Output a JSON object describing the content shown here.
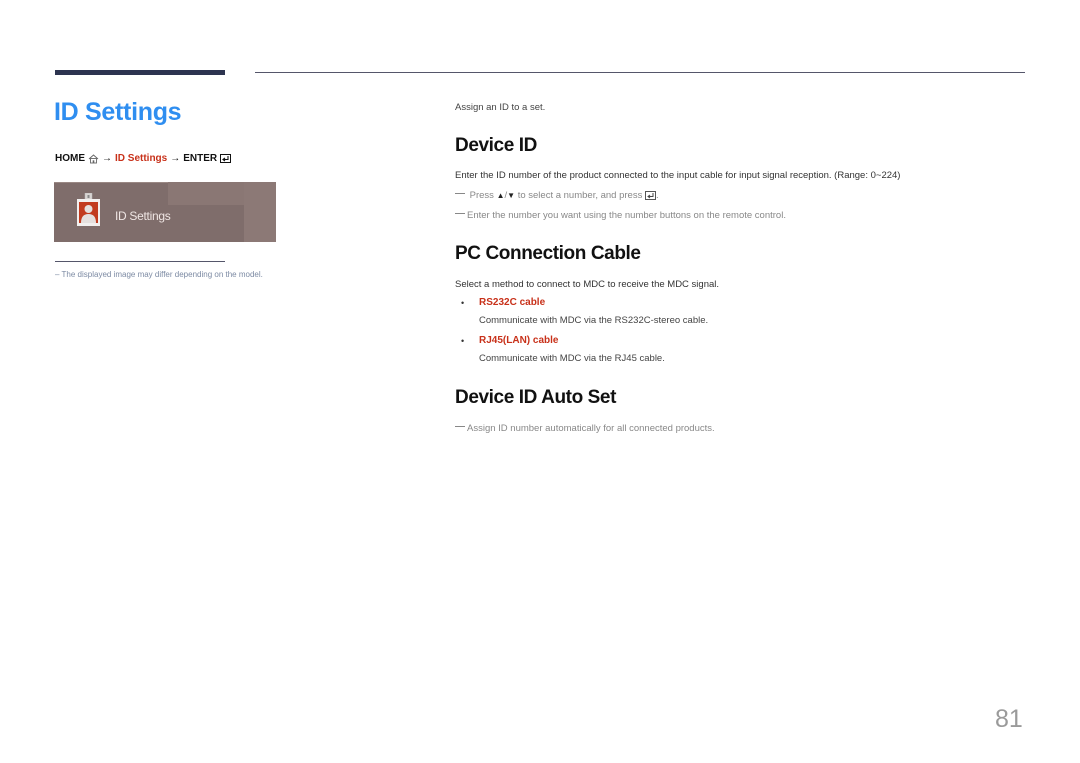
{
  "header": {
    "title": "ID Settings"
  },
  "breadcrumb": {
    "home": "HOME",
    "home_icon": "home-icon",
    "arrow1": "→",
    "current": "ID Settings",
    "arrow2": "→",
    "enter": "ENTER",
    "enter_icon": "enter-icon"
  },
  "osd_menu": {
    "icon": "id-badge-icon",
    "label": "ID Settings"
  },
  "footnote": "–  The displayed image may differ depending on the model.",
  "intro": "Assign an ID to a set.",
  "sections": [
    {
      "heading": "Device ID",
      "body": "Enter the ID number of the product connected to the input cable for input signal reception. (Range: 0~224)",
      "notes": [
        {
          "prefix": "Press",
          "up_icon": "▲",
          "separator": "/",
          "down_icon": "▼",
          "middle": "to select a number, and press",
          "suffix": "."
        },
        {
          "text": "Enter the number you want using the number buttons on the remote control."
        }
      ]
    },
    {
      "heading": "PC Connection Cable",
      "body": "Select a method to connect to MDC to receive the MDC signal.",
      "bullets": [
        {
          "marker": "•",
          "title": "RS232C cable",
          "description": "Communicate with MDC via the RS232C-stereo cable."
        },
        {
          "marker": "•",
          "title": "RJ45(LAN) cable",
          "description": "Communicate with MDC via the RJ45 cable."
        }
      ]
    },
    {
      "heading": "Device ID Auto Set",
      "notes": [
        {
          "text": "Assign ID number automatically for all connected products."
        }
      ]
    }
  ],
  "page_number": "81",
  "colors": {
    "title_blue": "#2f8ef0",
    "accent_red": "#c8311a",
    "bar_navy": "#2d3450"
  }
}
